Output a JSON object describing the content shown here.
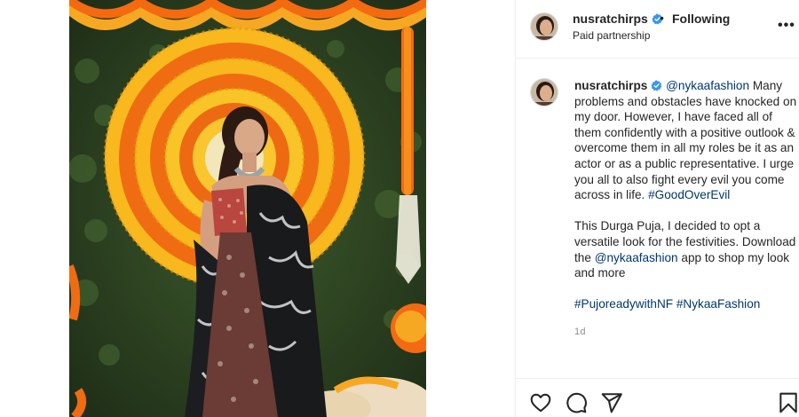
{
  "header": {
    "username": "nusratchirps",
    "separator": "•",
    "follow_label": "Following",
    "subtitle": "Paid partnership",
    "more_label": "•••"
  },
  "caption": {
    "username": "nusratchirps",
    "mention": "@nykaafashion",
    "paragraph1": "Many problems and obstacles have knocked on my door. However, I have faced all of them confidently with a positive outlook & overcome them in all my roles be it as an actor or as a public representative. I urge you all to also fight every evil you come across in life.",
    "hashtag1": "#GoodOverEvil",
    "paragraph2_before": "This Durga Puja, I decided to opt a versatile look for the festivities. Download the",
    "paragraph2_mention": "@nykaafashion",
    "paragraph2_after": "app to shop my look and more",
    "hashtag2": "#PujoreadywithNF",
    "hashtag3": "#NykaaFashion",
    "time_ago": "1d"
  },
  "icons": {
    "like": "heart-icon",
    "comment": "comment-icon",
    "share": "share-icon",
    "save": "bookmark-icon",
    "verified": "verified-badge-icon"
  },
  "colors": {
    "verified": "#3897f0",
    "link": "#00376b",
    "text": "#262626",
    "muted": "#8e8e8e"
  }
}
